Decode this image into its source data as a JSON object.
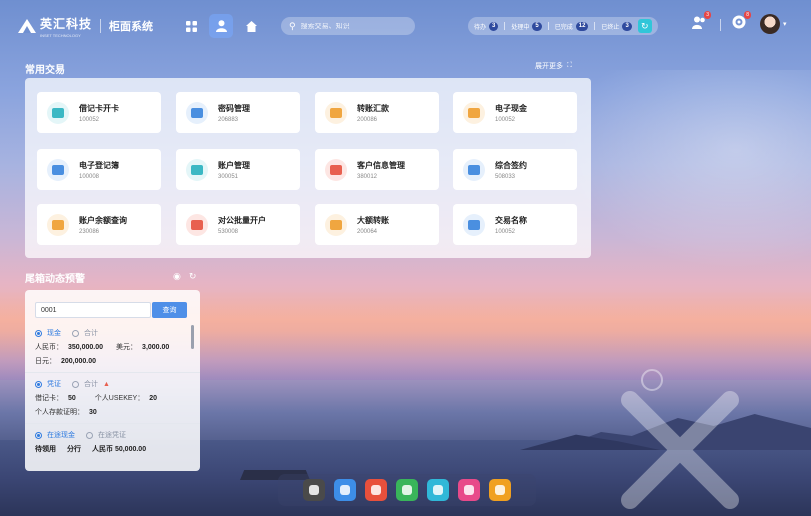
{
  "header": {
    "brand": "英汇科技",
    "brand_sub": "INSET TECHNOLOGY",
    "system_name": "柜面系统",
    "search_placeholder": "搜索交易、知识",
    "status": [
      {
        "label": "待办",
        "count": "3"
      },
      {
        "label": "处理中",
        "count": "5"
      },
      {
        "label": "已完成",
        "count": "12"
      },
      {
        "label": "已终止",
        "count": "3"
      }
    ],
    "user_badge": "3",
    "settings_badge": "8"
  },
  "common": {
    "title": "常用交易",
    "more": "展开更多",
    "items": [
      {
        "name": "借记卡开卡",
        "code": "100052",
        "icon": "card-icon",
        "color": "#3bb8c4",
        "bg": "#e4f6f8"
      },
      {
        "name": "密码管理",
        "code": "206883",
        "icon": "lock-icon",
        "color": "#4a8fe0",
        "bg": "#e6f0fc"
      },
      {
        "name": "转账汇款",
        "code": "200086",
        "icon": "transfer-icon",
        "color": "#f0a640",
        "bg": "#fdf1e0"
      },
      {
        "name": "电子现金",
        "code": "100052",
        "icon": "cloud-icon",
        "color": "#f0a640",
        "bg": "#fdf1e0"
      },
      {
        "name": "电子登记簿",
        "code": "100008",
        "icon": "ledger-icon",
        "color": "#4a8fe0",
        "bg": "#e6f0fc"
      },
      {
        "name": "账户管理",
        "code": "300051",
        "icon": "account-icon",
        "color": "#3bb8c4",
        "bg": "#e4f6f8"
      },
      {
        "name": "客户信息管理",
        "code": "380012",
        "icon": "customer-icon",
        "color": "#e8604f",
        "bg": "#fde6e3"
      },
      {
        "name": "综合签约",
        "code": "508033",
        "icon": "sign-icon",
        "color": "#4a8fe0",
        "bg": "#e6f0fc"
      },
      {
        "name": "账户余额查询",
        "code": "230086",
        "icon": "balance-icon",
        "color": "#f0a640",
        "bg": "#fdf1e0"
      },
      {
        "name": "对公批量开户",
        "code": "530008",
        "icon": "batch-icon",
        "color": "#e8604f",
        "bg": "#fde6e3"
      },
      {
        "name": "大额转账",
        "code": "200064",
        "icon": "bigtransfer-icon",
        "color": "#f0a640",
        "bg": "#fdf1e0"
      },
      {
        "name": "交易名称",
        "code": "100052",
        "icon": "list-icon",
        "color": "#4a8fe0",
        "bg": "#e6f0fc"
      }
    ]
  },
  "vault": {
    "title": "尾箱动态预警",
    "input_value": "0001",
    "query_button": "查询",
    "sec1": {
      "opt1": "现金",
      "opt2": "合计",
      "l1": "人民币：",
      "v1": "350,000.00",
      "l2": "美元：",
      "v2": "3,000.00",
      "l3": "日元：",
      "v3": "200,000.00"
    },
    "sec2": {
      "opt1": "凭证",
      "opt2": "合计",
      "l1": "借记卡：",
      "v1": "50",
      "l2": "个人USEKEY：",
      "v2": "20",
      "l3": "个人存款证明：",
      "v3": "30"
    },
    "sec3": {
      "opt1": "在途现金",
      "opt2": "在途凭证",
      "c1": "待领用",
      "c2": "分行",
      "c3": "人民币 50,000.00"
    }
  },
  "dock": [
    {
      "icon": "grid-app-icon",
      "color": "#4a4a4a"
    },
    {
      "icon": "globe-app-icon",
      "color": "#3d8ee8"
    },
    {
      "icon": "monitor-app-icon",
      "color": "#e8503c"
    },
    {
      "icon": "chat-app-icon",
      "color": "#39b55a"
    },
    {
      "icon": "calendar-app-icon",
      "color": "#30b8d8"
    },
    {
      "icon": "shirt-app-icon",
      "color": "#e84a8a"
    },
    {
      "icon": "puzzle-app-icon",
      "color": "#f0a020"
    }
  ]
}
